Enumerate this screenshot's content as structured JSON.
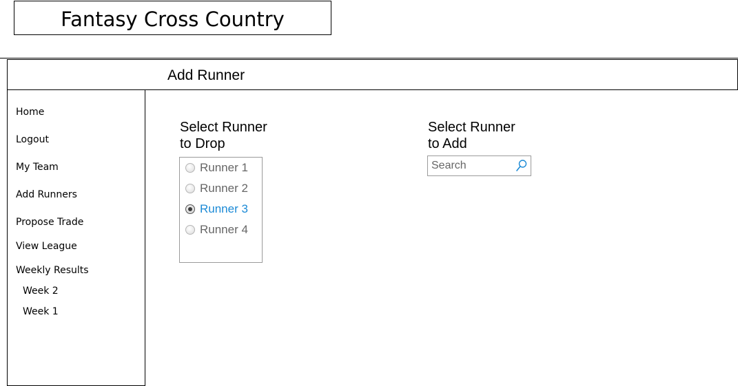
{
  "app": {
    "title": "Fantasy Cross Country"
  },
  "page": {
    "title": "Add Runner"
  },
  "sidebar": {
    "items": [
      {
        "label": "Home"
      },
      {
        "label": "Logout"
      },
      {
        "label": "My Team"
      },
      {
        "label": "Add Runners"
      },
      {
        "label": "Propose Trade"
      },
      {
        "label": "View League"
      },
      {
        "label": "Weekly Results"
      }
    ],
    "subitems": [
      {
        "label": "Week 2"
      },
      {
        "label": "Week 1"
      }
    ]
  },
  "drop_section": {
    "heading_line1": "Select Runner",
    "heading_line2": "to Drop",
    "runners": [
      {
        "label": "Runner 1",
        "selected": false
      },
      {
        "label": "Runner 2",
        "selected": false
      },
      {
        "label": "Runner 3",
        "selected": true
      },
      {
        "label": "Runner 4",
        "selected": false
      }
    ]
  },
  "add_section": {
    "heading_line1": "Select Runner",
    "heading_line2": "to Add",
    "search": {
      "placeholder": "Search",
      "value": "",
      "icon": "search-icon"
    }
  },
  "colors": {
    "selected_text": "#1b8ad6",
    "unselected_text": "#666666",
    "border": "#000000",
    "control_border": "#9a9a9a"
  }
}
